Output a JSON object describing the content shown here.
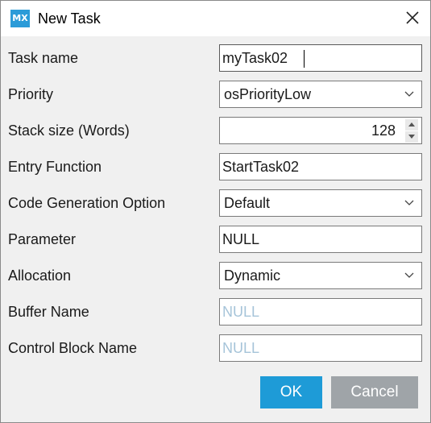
{
  "window": {
    "title": "New Task",
    "logo_text": "MX"
  },
  "fields": {
    "task_name": {
      "label": "Task name",
      "value": "myTask02"
    },
    "priority": {
      "label": "Priority",
      "value": "osPriorityLow"
    },
    "stack_size": {
      "label": "Stack size (Words)",
      "value": "128"
    },
    "entry_function": {
      "label": "Entry Function",
      "value": "StartTask02"
    },
    "code_generation": {
      "label": "Code Generation Option",
      "value": "Default"
    },
    "parameter": {
      "label": "Parameter",
      "value": "NULL"
    },
    "allocation": {
      "label": "Allocation",
      "value": "Dynamic"
    },
    "buffer_name": {
      "label": "Buffer Name",
      "placeholder": "NULL"
    },
    "control_block_name": {
      "label": "Control Block Name",
      "placeholder": "NULL"
    }
  },
  "buttons": {
    "ok": "OK",
    "cancel": "Cancel"
  },
  "colors": {
    "accent": "#1e9bd7",
    "cancel": "#9fa4a8",
    "logo": "#2b9bd8",
    "placeholder": "#a6c4d9"
  }
}
